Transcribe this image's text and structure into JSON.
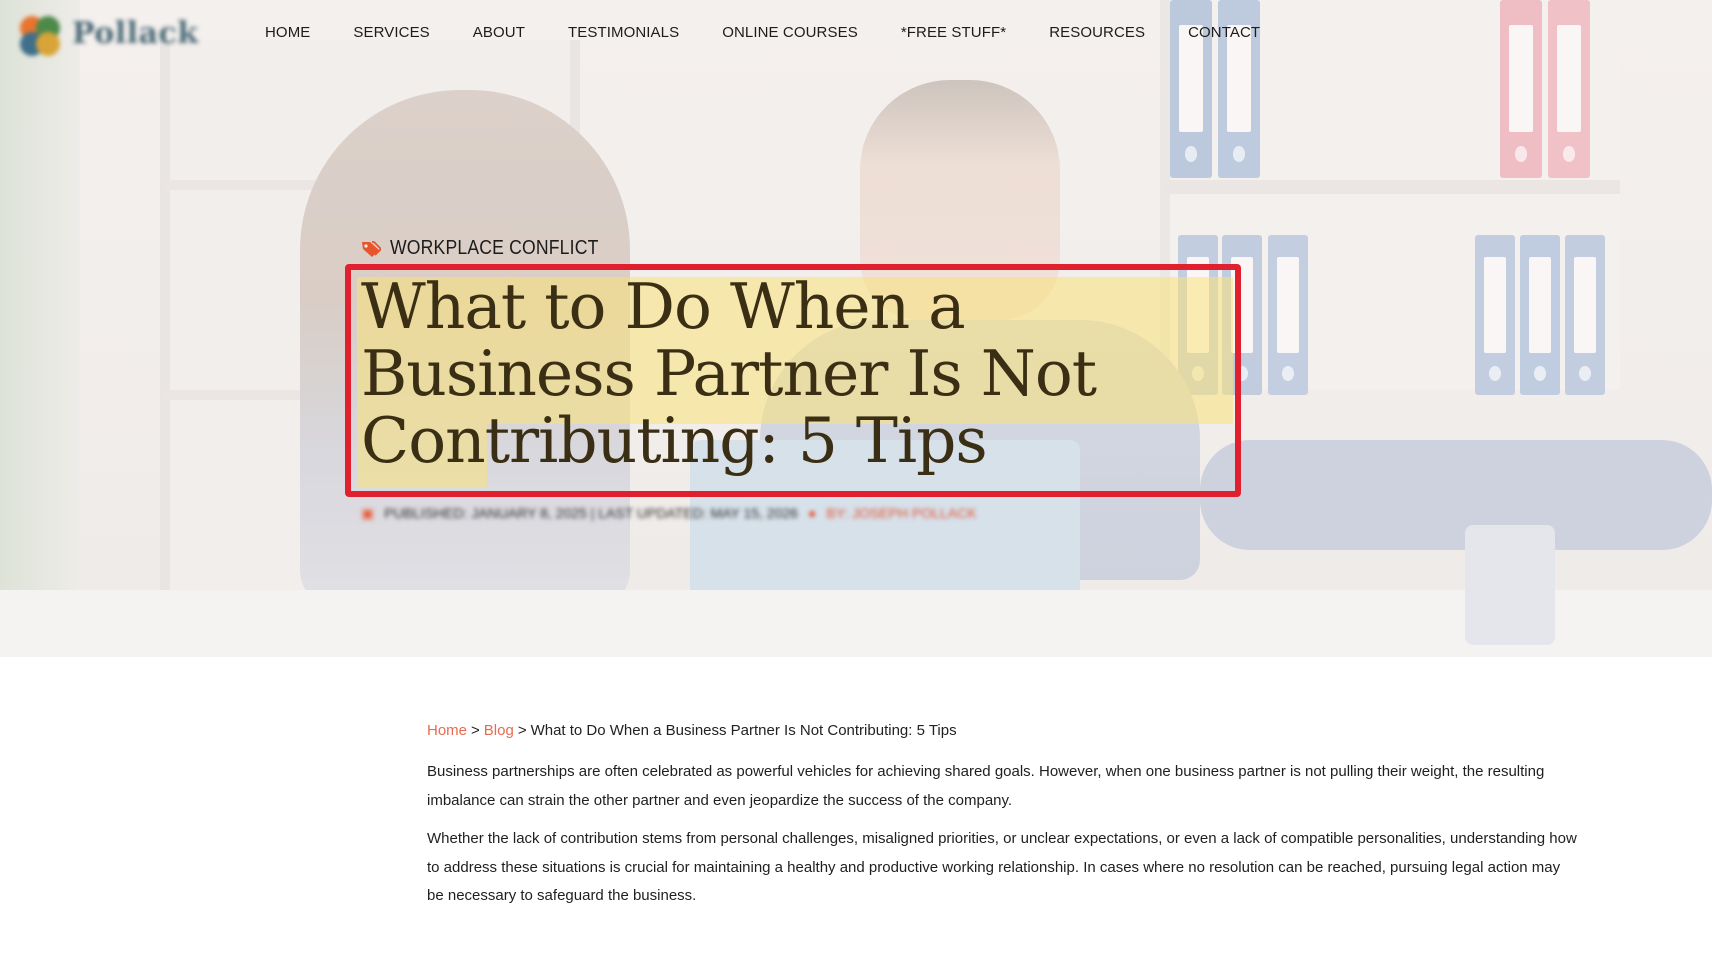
{
  "logo": {
    "text": "Pollack"
  },
  "nav": {
    "items": [
      {
        "label": "HOME"
      },
      {
        "label": "SERVICES"
      },
      {
        "label": "ABOUT"
      },
      {
        "label": "TESTIMONIALS"
      },
      {
        "label": "ONLINE COURSES"
      },
      {
        "label": "*FREE STUFF*"
      },
      {
        "label": "RESOURCES"
      },
      {
        "label": "CONTACT"
      }
    ]
  },
  "hero": {
    "category": "WORKPLACE CONFLICT",
    "title": "What to Do When a Business Partner Is Not Contributing: 5 Tips",
    "meta": {
      "published": "PUBLISHED: JANUARY 8, 2025 | LAST UPDATED: MAY 15, 2026",
      "author": "BY: JOSEPH POLLACK"
    },
    "highlight_color": "#e0202e"
  },
  "breadcrumb": {
    "home": "Home",
    "blog": "Blog",
    "current": "What to Do When a Business Partner Is Not Contributing: 5 Tips",
    "separator": ">"
  },
  "article": {
    "paragraphs": [
      "Business partnerships are often celebrated as powerful vehicles for achieving shared goals. However, when one business partner is not pulling their weight, the resulting imbalance can strain the other partner and even jeopardize the success of the company.",
      "Whether the lack of contribution stems from personal challenges, misaligned priorities, or unclear expectations, or even a lack of compatible personalities, understanding how to address these situations is crucial for maintaining a healthy and productive working relationship. In cases where no resolution can be reached, pursuing legal action may be necessary to safeguard the business."
    ]
  },
  "colors": {
    "link": "#e86b4f",
    "tag_icon": "#e8542c"
  },
  "icons": {
    "category": "tag-icon",
    "meta": "calendar-icon",
    "author": "user-icon"
  }
}
